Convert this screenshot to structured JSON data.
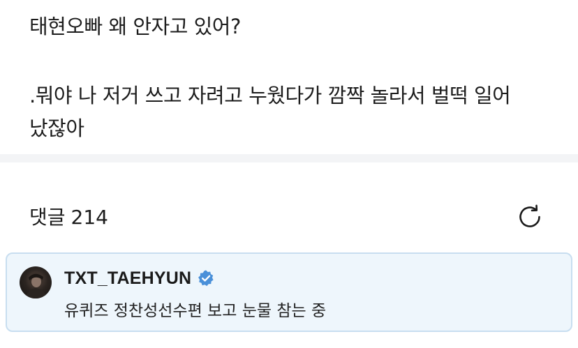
{
  "post": {
    "lines": [
      "태현오빠 왜 안자고 있어?",
      ".뭐야 나 저거 쓰고 자려고 누웠다가 깜짝 놀라서 벌떡 일어",
      "났잖아"
    ]
  },
  "comments": {
    "label": "댓글",
    "count": "214",
    "refresh_icon": "refresh-icon"
  },
  "comment": {
    "author": "TXT_TAEHYUN",
    "verified_icon": "verified-badge-icon",
    "verified_color": "#4a90d9",
    "text": "유퀴즈 정찬성선수편 보고 눈물 참는 중"
  },
  "colors": {
    "card_background": "#eef6fc",
    "card_border": "#c8def0",
    "separator": "#f3f4f6"
  }
}
